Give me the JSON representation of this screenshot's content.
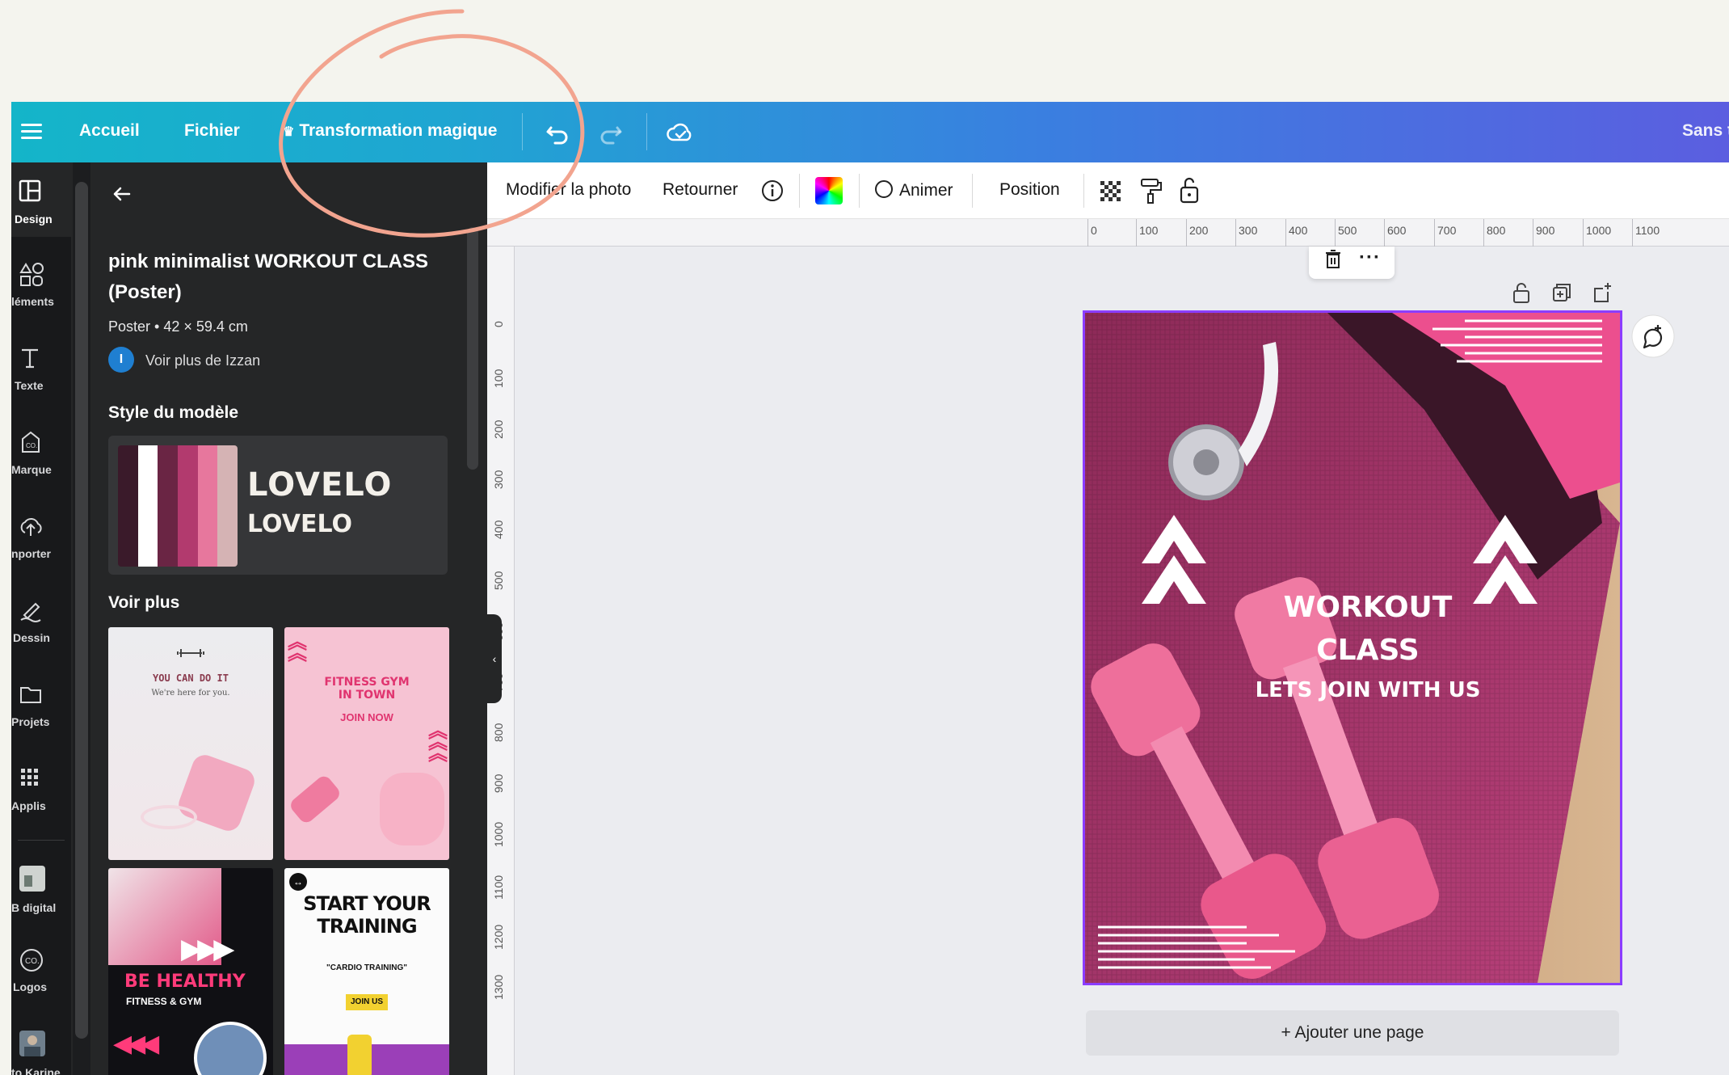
{
  "topbar": {
    "home": "Accueil",
    "file": "Fichier",
    "magic": "Transformation magique",
    "title_partial": "Sans t"
  },
  "rail": [
    {
      "label": "Design",
      "icon": "layout-icon"
    },
    {
      "label": "léments",
      "icon": "elements-icon"
    },
    {
      "label": "Texte",
      "icon": "text-icon"
    },
    {
      "label": "Marque",
      "icon": "brand-icon"
    },
    {
      "label": "nporter",
      "icon": "upload-icon"
    },
    {
      "label": "Dessin",
      "icon": "draw-icon"
    },
    {
      "label": "Projets",
      "icon": "folder-icon"
    },
    {
      "label": "Applis",
      "icon": "apps-icon"
    },
    {
      "label": "B digital",
      "icon": "app-thumb-icon"
    },
    {
      "label": "Logos",
      "icon": "logos-icon"
    },
    {
      "label": "to Karine",
      "icon": "photo-icon"
    }
  ],
  "panel": {
    "title": "pink minimalist WORKOUT CLASS (Poster)",
    "meta": "Poster • 42 × 59.4 cm",
    "author_initial": "I",
    "author": "Voir plus de Izzan",
    "style_heading": "Style du modèle",
    "style_font_1": "LOVELO",
    "style_font_2": "LOVELO",
    "more_heading": "Voir plus",
    "thumbs": {
      "t1_line1": "YOU CAN DO IT",
      "t1_line2": "We're here for you.",
      "t2_line1": "FITNESS GYM",
      "t2_line2": "IN TOWN",
      "t2_line3": "JOIN NOW",
      "t3_line1": "BE HEALTHY",
      "t3_line2": "FITNESS & GYM",
      "t4_line1": "START YOUR",
      "t4_line2": "TRAINING",
      "t4_line3": "\"CARDIO TRAINING\"",
      "t4_line4": "JOIN US"
    }
  },
  "swatches": [
    "#3a1a2a",
    "#ffffff",
    "#6a2544",
    "#b23a6e",
    "#e7779d",
    "#d5b3b4"
  ],
  "toolbar": {
    "edit_photo": "Modifier la photo",
    "flip": "Retourner",
    "animate": "Animer",
    "position": "Position"
  },
  "ruler_top": [
    "0",
    "100",
    "200",
    "300",
    "400",
    "500",
    "600",
    "700",
    "800",
    "900",
    "1000",
    "1100"
  ],
  "ruler_left": [
    "0",
    "100",
    "200",
    "300",
    "400",
    "500",
    "600",
    "700",
    "800",
    "900",
    "1000",
    "1100",
    "1200",
    "1300"
  ],
  "poster": {
    "line1": "WORKOUT",
    "line2": "CLASS",
    "line3": "LETS JOIN WITH US"
  },
  "add_page": "+ Ajouter une page",
  "colors": {
    "accent": "#8b3dff",
    "annotation": "#f2a48f",
    "panel_bg": "#252627"
  }
}
